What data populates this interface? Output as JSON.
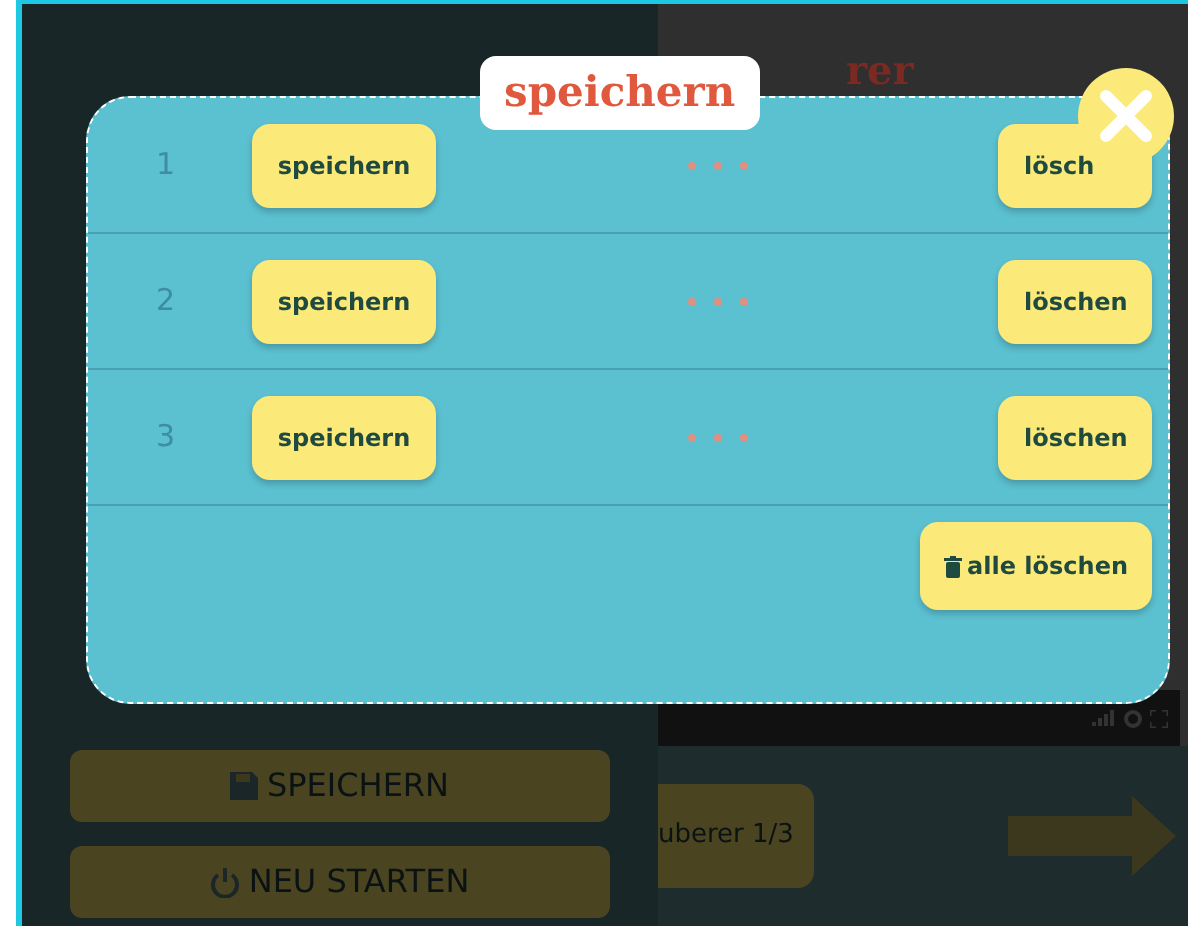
{
  "background": {
    "title_fragment": "rer",
    "buttons": [
      {
        "kind": "save",
        "label": "SPEICHERN"
      },
      {
        "kind": "restart",
        "label": "NEU STARTEN"
      }
    ],
    "level_button": "uberer 1/3"
  },
  "dialog": {
    "title": "speichern",
    "slots": [
      {
        "number": "1",
        "save": "speichern",
        "delete": "lösch"
      },
      {
        "number": "2",
        "save": "speichern",
        "delete": "löschen"
      },
      {
        "number": "3",
        "save": "speichern",
        "delete": "löschen"
      }
    ],
    "delete_all": "alle löschen"
  }
}
